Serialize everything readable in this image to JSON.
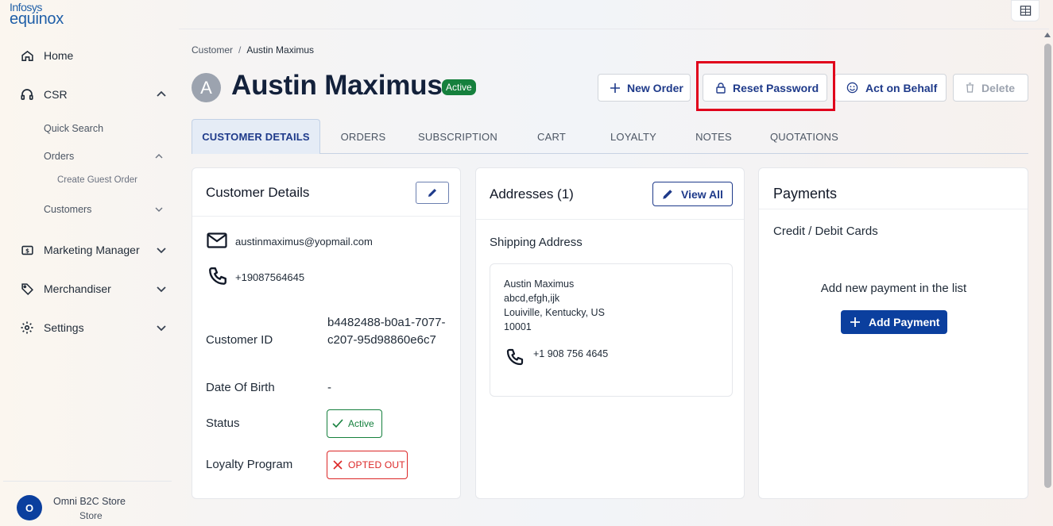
{
  "brand": {
    "line1": "Infosys",
    "line2": "equinox"
  },
  "sidebar": {
    "home": "Home",
    "csr": "CSR",
    "quick_search": "Quick Search",
    "orders": "Orders",
    "create_guest_order": "Create Guest Order",
    "customers": "Customers",
    "marketing_manager": "Marketing Manager",
    "merchandiser": "Merchandiser",
    "settings": "Settings",
    "store": {
      "initial": "O",
      "name": "Omni B2C Store",
      "role": "Store"
    }
  },
  "breadcrumb": {
    "parent": "Customer",
    "separator": "/",
    "current": "Austin Maximus"
  },
  "customer": {
    "initial": "A",
    "name": "Austin Maximus",
    "status_badge": "Active"
  },
  "actions": {
    "new_order": "New Order",
    "reset_password": "Reset Password",
    "act_on_behalf": "Act on Behalf",
    "delete": "Delete"
  },
  "tabs": [
    "CUSTOMER DETAILS",
    "ORDERS",
    "SUBSCRIPTION",
    "CART",
    "LOYALTY",
    "NOTES",
    "QUOTATIONS"
  ],
  "customer_details": {
    "title": "Customer Details",
    "email": "austinmaximus@yopmail.com",
    "phone": "+19087564645",
    "id_label": "Customer ID",
    "id_value": "b4482488-b0a1-7077-c207-95d98860e6c7",
    "dob_label": "Date Of Birth",
    "dob_value": "-",
    "status_label": "Status",
    "status_value": "Active",
    "loyalty_label": "Loyalty Program",
    "loyalty_value": "OPTED OUT"
  },
  "addresses": {
    "title": "Addresses (1)",
    "view_all": "View All",
    "shipping_title": "Shipping Address",
    "name": "Austin Maximus",
    "line1": "abcd,efgh,ijk",
    "line2": "Louiville, Kentucky, US",
    "zip": "10001",
    "phone": "+1 908 756 4645"
  },
  "payments": {
    "title": "Payments",
    "subtitle": "Credit / Debit Cards",
    "empty_message": "Add new payment in the list",
    "add_button": "Add Payment"
  },
  "colors": {
    "brand_blue": "#0b3f9e",
    "navy_text": "#1e3a8a",
    "success": "#15803d",
    "danger": "#dc2626",
    "highlight": "#e0001b"
  }
}
